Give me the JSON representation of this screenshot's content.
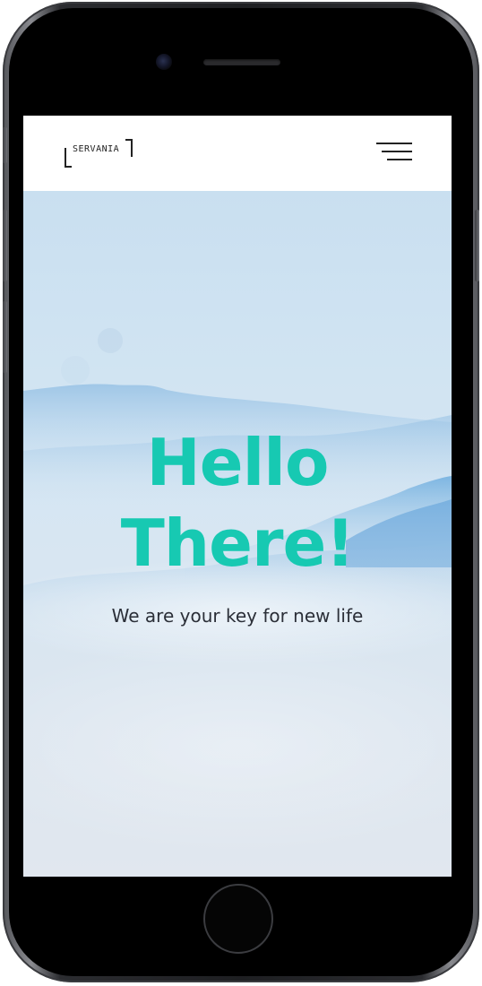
{
  "navbar": {
    "logo_text": "SERVANIA",
    "menu_icon": "hamburger-menu-icon"
  },
  "hero": {
    "title_line1": "Hello",
    "title_line2": "There!",
    "subtitle": "We are your key for new life"
  },
  "colors": {
    "accent": "#17c9b2",
    "text_dark": "#2b2f38",
    "navbar_bg": "#ffffff",
    "hero_bg_top": "#c9dff0",
    "hero_bg_bottom": "#e1e7ef"
  }
}
